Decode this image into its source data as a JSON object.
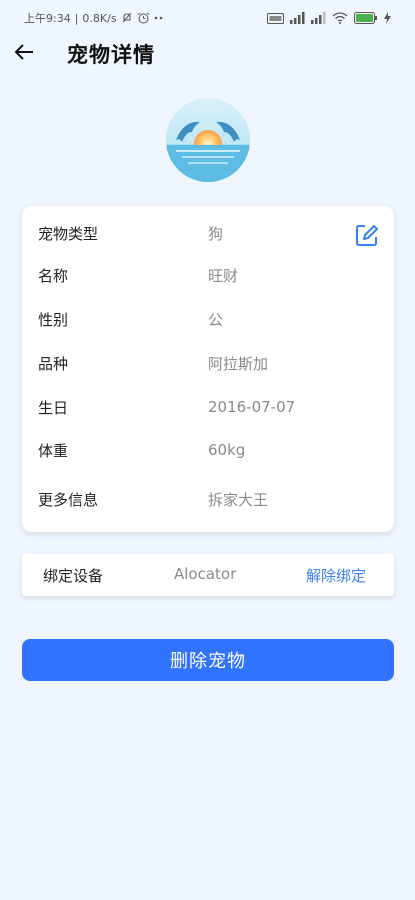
{
  "status_bar": {
    "time": "上午9:34",
    "network_speed": "0.8K/s",
    "battery": "100",
    "icons": [
      "mute-icon",
      "alarm-icon",
      "more-icon",
      "volte-icon",
      "signal-icon",
      "signal-icon",
      "wifi-icon",
      "battery-icon",
      "charging-icon"
    ]
  },
  "header": {
    "title": "宠物详情",
    "back_icon": "arrow-left-icon"
  },
  "avatar": {
    "icon": "dolphins-sunset-avatar"
  },
  "pet_info": {
    "edit_icon": "edit-icon",
    "rows": [
      {
        "label": "宠物类型",
        "value": "狗"
      },
      {
        "label": "名称",
        "value": "旺财"
      },
      {
        "label": "性别",
        "value": "公"
      },
      {
        "label": "品种",
        "value": "阿拉斯加"
      },
      {
        "label": "生日",
        "value": "2016-07-07"
      },
      {
        "label": "体重",
        "value": "60kg"
      },
      {
        "label": "更多信息",
        "value": "拆家大王"
      }
    ]
  },
  "device": {
    "label": "绑定设备",
    "value": "Alocator",
    "unbind_label": "解除绑定"
  },
  "actions": {
    "delete_label": "删除宠物"
  },
  "colors": {
    "background": "#f0f6ff",
    "accent": "#2f73ff",
    "link": "#3a7ef0",
    "value_text": "#8a8a8a"
  }
}
